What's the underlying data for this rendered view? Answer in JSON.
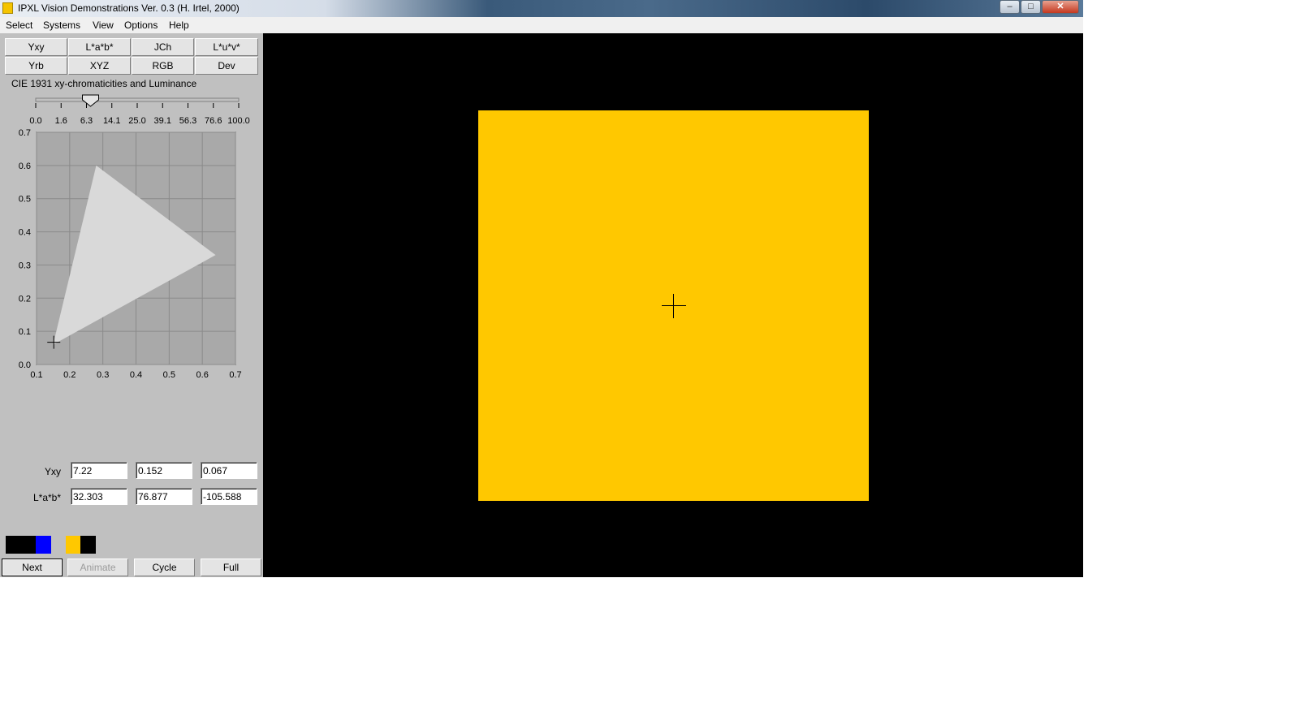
{
  "window": {
    "title": "IPXL Vision Demonstrations Ver. 0.3 (H. Irtel, 2000)",
    "controls": {
      "minimize": "–",
      "maximize": "□",
      "close": "✕"
    }
  },
  "menu": [
    "Select",
    "Systems",
    "View",
    "Options",
    "Help"
  ],
  "systems": {
    "row1": [
      "Yxy",
      "L*a*b*",
      "JCh",
      "L*u*v*"
    ],
    "row2": [
      "Yrb",
      "XYZ",
      "RGB",
      "Dev"
    ]
  },
  "subtitle": "CIE 1931 xy-chromaticities and Luminance",
  "slider": {
    "ticks": [
      "0.0",
      "1.6",
      "6.3",
      "14.1",
      "25.0",
      "39.1",
      "56.3",
      "76.6",
      "100.0"
    ],
    "value_fraction": 0.27
  },
  "chart_data": {
    "type": "scatter",
    "xlim": [
      0.1,
      0.7
    ],
    "ylim": [
      0.0,
      0.7
    ],
    "x_ticks": [
      "0.1",
      "0.2",
      "0.3",
      "0.4",
      "0.5",
      "0.6",
      "0.7"
    ],
    "y_ticks": [
      "0.0",
      "0.1",
      "0.2",
      "0.3",
      "0.4",
      "0.5",
      "0.6",
      "0.7"
    ],
    "grid": true,
    "gamut_triangle": [
      [
        0.15,
        0.06
      ],
      [
        0.28,
        0.6
      ],
      [
        0.64,
        0.33
      ]
    ],
    "current_point": {
      "x": 0.152,
      "y": 0.067
    }
  },
  "fields": {
    "yxy": {
      "label": "Yxy",
      "values": [
        "7.22",
        "0.152",
        "0.067"
      ]
    },
    "lab": {
      "label": "L*a*b*",
      "values": [
        "32.303",
        "76.877",
        "-105.588"
      ]
    }
  },
  "swatches": [
    "#000000",
    "#0000ff",
    "#c0c0c0",
    "#ffc800",
    "#000000"
  ],
  "buttons": {
    "next": "Next",
    "animate": "Animate",
    "cycle": "Cycle",
    "full": "Full"
  },
  "stimulus_color": "#ffc800"
}
